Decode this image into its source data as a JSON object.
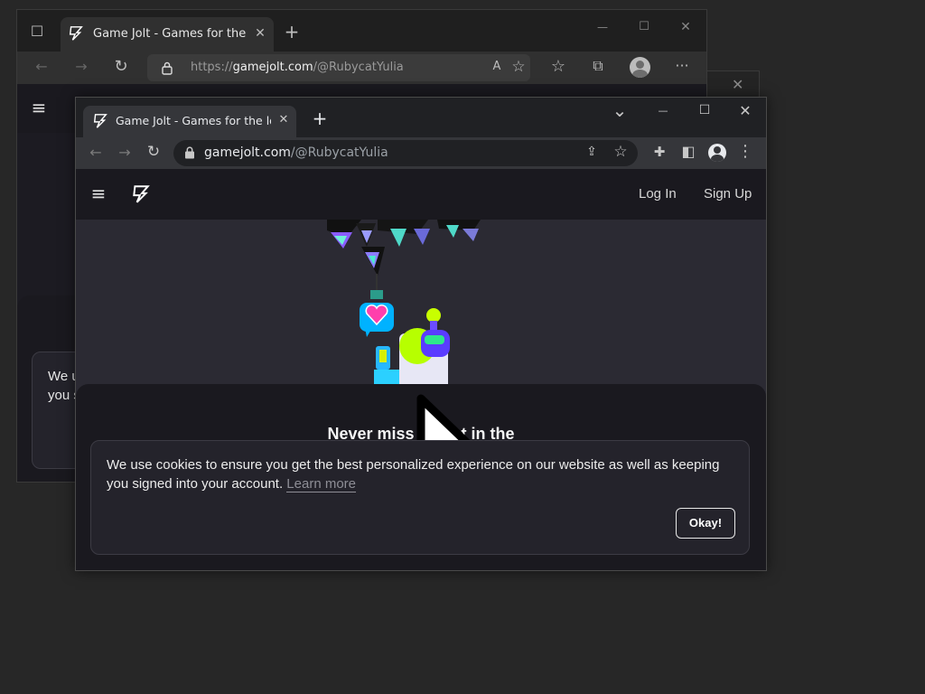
{
  "back_window": {
    "tab_title": "Game Jolt - Games for the love o",
    "url_prefix": "https://",
    "url_domain": "gamejolt.com",
    "url_path": "/@RubycatYulia",
    "partial_text_line1": "We u",
    "partial_text_line2": "you s",
    "icons": {
      "sidebar": "☐",
      "close_tab": "✕",
      "new_tab": "+",
      "minimize": "—",
      "maximize": "☐",
      "close": "✕",
      "back": "←",
      "forward": "→",
      "reload": "↻",
      "lock": "🔒",
      "read_aloud": "A",
      "add_favorite": "☆",
      "favorites": "☆",
      "collections": "⧉",
      "more": "···",
      "menu": "≡"
    }
  },
  "front_window": {
    "tab_title": "Game Jolt - Games for the love o",
    "url_domain": "gamejolt.com",
    "url_path": "/@RubycatYulia",
    "icons": {
      "close_tab": "✕",
      "new_tab": "+",
      "tab_search": "⌄",
      "minimize": "—",
      "maximize": "☐",
      "close": "✕",
      "back": "←",
      "forward": "→",
      "reload": "↻",
      "lock": "🔒",
      "share": "⇪",
      "bookmark": "☆",
      "extensions": "✚",
      "side_panel": "◧",
      "profile": "●",
      "more": "⋮",
      "menu": "≡"
    }
  },
  "site": {
    "nav": {
      "login": "Log In",
      "signup": "Sign Up"
    },
    "headline": "Never miss a post in the",
    "cookie": {
      "text": "We use cookies to ensure you get the best personalized experience on our website as well as keeping you signed into your account.",
      "learn_more": "Learn more",
      "okay": "Okay!"
    }
  },
  "colors": {
    "gj_green": "#ccff00",
    "gj_pink": "#ff3fac",
    "gj_cyan": "#2f7fff"
  }
}
